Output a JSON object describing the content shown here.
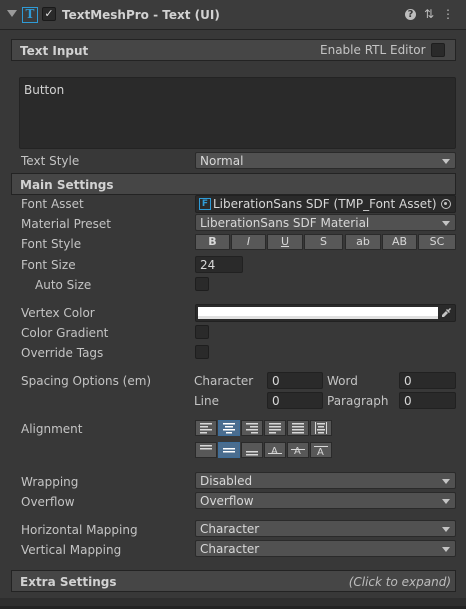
{
  "header": {
    "title": "TextMeshPro - Text (UI)",
    "component_icon": "T",
    "enabled_mark": "✓",
    "help_glyph": "?",
    "presets_glyph": "⇅",
    "menu_glyph": "⋮"
  },
  "text_input": {
    "section_label": "Text Input",
    "rtl_label": "Enable RTL Editor",
    "text": "Button",
    "style_label": "Text Style",
    "style_value": "Normal"
  },
  "main_settings": {
    "section_label": "Main Settings",
    "font_asset_label": "Font Asset",
    "font_asset_icon": "F",
    "font_asset_value": "LiberationSans SDF (TMP_Font Asset)",
    "material_preset_label": "Material Preset",
    "material_preset_value": "LiberationSans SDF Material",
    "font_style_label": "Font Style",
    "font_style_buttons": [
      "B",
      "I",
      "U",
      "S",
      "ab",
      "AB",
      "SC"
    ],
    "font_size_label": "Font Size",
    "font_size_value": "24",
    "auto_size_label": "Auto Size",
    "vertex_color_label": "Vertex Color",
    "vertex_color": "#ffffff",
    "color_gradient_label": "Color Gradient",
    "override_tags_label": "Override Tags",
    "spacing_label": "Spacing Options (em)",
    "character_label": "Character",
    "character_value": "0",
    "word_label": "Word",
    "word_value": "0",
    "line_label": "Line",
    "line_value": "0",
    "paragraph_label": "Paragraph",
    "paragraph_value": "0",
    "alignment_label": "Alignment",
    "horizontal_alignment_icons": [
      "align-left-icon",
      "align-center-icon",
      "align-right-icon",
      "align-justified-icon",
      "align-flush-icon",
      "align-geometry-center-icon"
    ],
    "vertical_alignment_icons": [
      "align-top-icon",
      "align-middle-icon",
      "align-bottom-icon",
      "align-baseline-icon",
      "align-midline-icon",
      "align-capline-icon"
    ],
    "wrapping_label": "Wrapping",
    "wrapping_value": "Disabled",
    "overflow_label": "Overflow",
    "overflow_value": "Overflow",
    "horizontal_mapping_label": "Horizontal Mapping",
    "horizontal_mapping_value": "Character",
    "vertical_mapping_label": "Vertical Mapping",
    "vertical_mapping_value": "Character"
  },
  "extra_settings": {
    "section_label": "Extra Settings",
    "hint": "(Click to expand)"
  },
  "colors": {
    "background": "#383838",
    "section": "#464646",
    "field": "#2a2a2a",
    "accent": "#2f9bd6",
    "active_button": "#4a6d8f"
  }
}
